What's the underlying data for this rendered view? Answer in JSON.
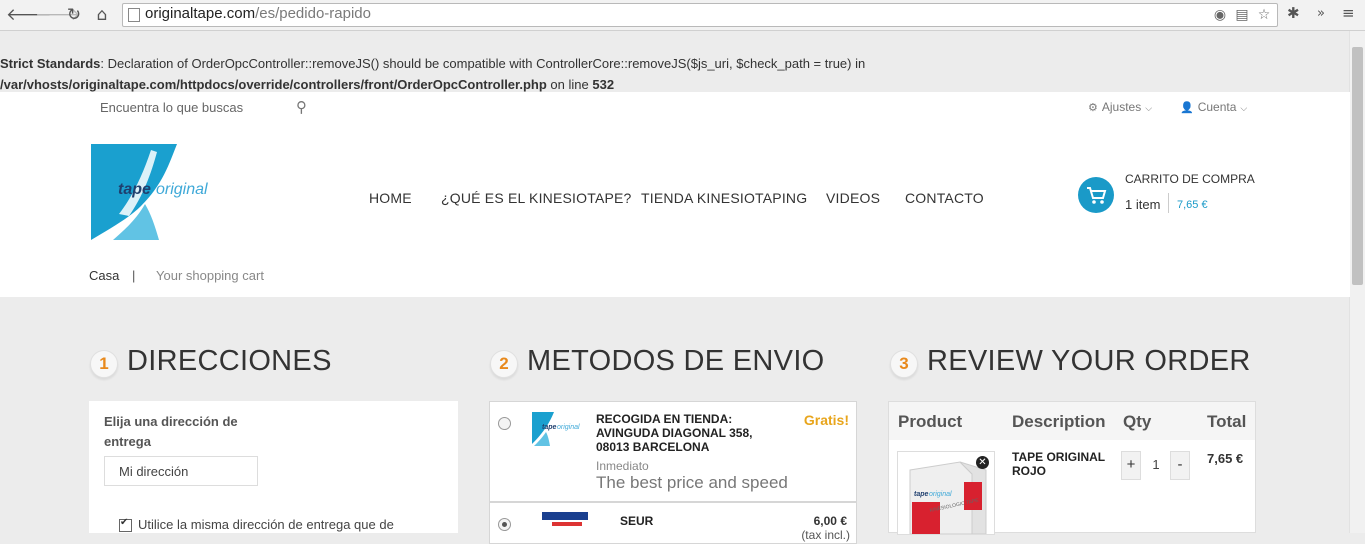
{
  "browser": {
    "url_host": "originaltape.com",
    "url_path": "/es/pedido-rapido",
    "back_icon": "back-arrow-icon",
    "forward_icon": "forward-arrow-icon",
    "reload_icon": "reload-icon",
    "home_icon": "home-icon",
    "bookmark_icon": "star-icon",
    "menu_icon": "overflow-chevron-icon"
  },
  "warning": {
    "label": "Strict Standards",
    "message": ": Declaration of OrderOpcController::removeJS() should be compatible with ControllerCore::removeJS($js_uri, $check_path = true) in",
    "path": "/var/vhosts/originaltape.com/httpdocs/override/controllers/front/OrderOpcController.php",
    "on_line": " on line ",
    "line": "532"
  },
  "header": {
    "search_placeholder": "Encuentra lo que buscas",
    "settings_label": "Ajustes",
    "account_label": "Cuenta",
    "logo_text_bold": "tape",
    "logo_text": "original",
    "nav": [
      "HOME",
      "¿QUÉ ES EL KINESIOTAPE?",
      "TIENDA KINESIOTAPING",
      "VIDEOS",
      "CONTACTO"
    ],
    "cart_title": "CARRITO DE COMPRA",
    "cart_items": "1 item",
    "cart_total": "7,65 €",
    "colors": {
      "accent": "#1a9ac8",
      "step_number": "#e8891c"
    }
  },
  "breadcrumb": {
    "home": "Casa",
    "separator": "|",
    "current": "Your shopping cart"
  },
  "steps": {
    "addresses": {
      "number": "1",
      "title": "DIRECCIONES"
    },
    "shipping": {
      "number": "2",
      "title": "METODOS DE ENVIO"
    },
    "review": {
      "number": "3",
      "title": "REVIEW YOUR ORDER"
    }
  },
  "address": {
    "label": "Elija una dirección de entrega",
    "selected": "Mi dirección",
    "same_address": "Utilice la misma dirección de entrega que de",
    "same_address_checked": true
  },
  "shipping": {
    "options": [
      {
        "name": "RECOGIDA EN TIENDA: AVINGUDA DIAGONAL 358, 08013 BARCELONA",
        "delay": "Inmediato",
        "desc": "The best price and speed",
        "price": "Gratis!",
        "selected": false
      },
      {
        "name": "SEUR",
        "price": "6,00 €",
        "price_note": "(tax incl.)",
        "selected": true
      }
    ]
  },
  "review": {
    "headers": [
      "Product",
      "Description",
      "Qty",
      "Total"
    ],
    "items": [
      {
        "description": "TAPE ORIGINAL ROJO",
        "qty": "1",
        "total": "7,65 €",
        "box_text": "KINESIOLOGIC TAPE"
      }
    ],
    "plus": "+",
    "minus": "-",
    "remove_icon": "remove-x-icon"
  }
}
